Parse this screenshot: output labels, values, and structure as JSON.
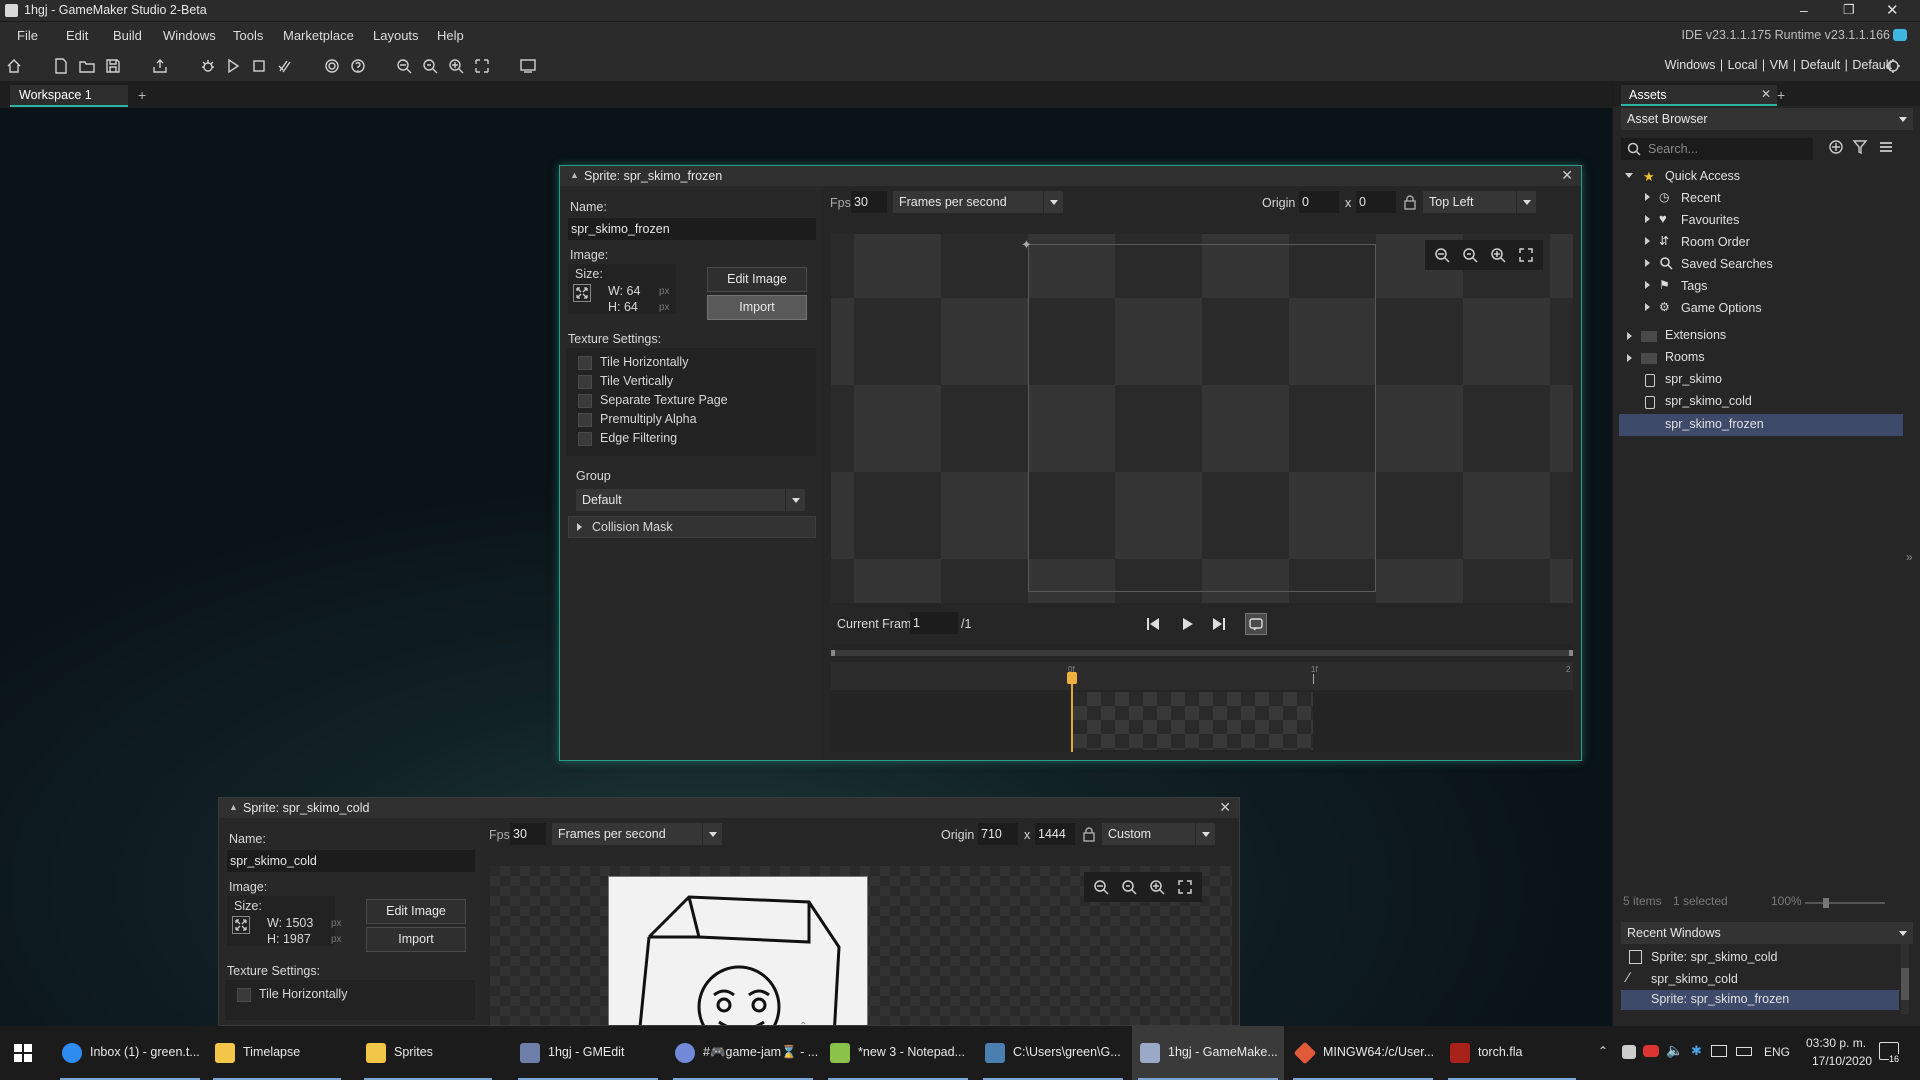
{
  "titlebar": {
    "title": "1hgj - GameMaker Studio 2-Beta"
  },
  "menu": [
    "File",
    "Edit",
    "Build",
    "Windows",
    "Tools",
    "Marketplace",
    "Layouts",
    "Help"
  ],
  "ide_version": "IDE v23.1.1.175  Runtime v23.1.1.166",
  "targets": "Windows  |  Local  |  VM  |  Default  |  Default",
  "workspace_tab": "Workspace 1",
  "add_tab": "+",
  "sprite_frozen": {
    "title": "Sprite: spr_skimo_frozen",
    "name_label": "Name:",
    "name": "spr_skimo_frozen",
    "image_label": "Image:",
    "size_label": "Size:",
    "w": "W: 64",
    "h": "H: 64",
    "px": "px",
    "edit_image": "Edit Image",
    "import": "Import",
    "texture_label": "Texture Settings:",
    "checkboxes": [
      "Tile Horizontally",
      "Tile Vertically",
      "Separate Texture Page",
      "Premultiply Alpha",
      "Edge Filtering"
    ],
    "group_label": "Group",
    "group": "Default",
    "collision": "Collision Mask",
    "fps_label": "Fps",
    "fps": "30",
    "fps_mode": "Frames per second",
    "origin_label": "Origin",
    "origin_x": "0",
    "x_sep": "x",
    "origin_y": "0",
    "origin_mode": "Top Left",
    "current_frame_label": "Current Frame:",
    "current_frame": "1",
    "frame_total": "/1",
    "frame_ticks": [
      "0f",
      "1f",
      "2"
    ]
  },
  "sprite_cold": {
    "title": "Sprite: spr_skimo_cold",
    "name_label": "Name:",
    "name": "spr_skimo_cold",
    "image_label": "Image:",
    "size_label": "Size:",
    "w": "W: 1503",
    "h": "H: 1987",
    "px": "px",
    "edit_image": "Edit Image",
    "import": "Import",
    "texture_label": "Texture Settings:",
    "checkbox": "Tile Horizontally",
    "fps_label": "Fps",
    "fps": "30",
    "fps_mode": "Frames per second",
    "origin_label": "Origin",
    "origin_x": "710",
    "x_sep": "x",
    "origin_y": "1444",
    "origin_mode": "Custom"
  },
  "assets": {
    "tab": "Assets",
    "tab_add": "+",
    "browser": "Asset Browser",
    "search_placeholder": "Search...",
    "quick_access": "Quick Access",
    "quick_items": [
      "Recent",
      "Favourites",
      "Room Order",
      "Saved Searches",
      "Tags",
      "Game Options"
    ],
    "folders": [
      "Extensions",
      "Rooms"
    ],
    "sprites": [
      "spr_skimo",
      "spr_skimo_cold",
      "spr_skimo_frozen"
    ],
    "status_items": "5 items",
    "status_selected": "1 selected",
    "zoom": "100%",
    "recent_title": "Recent Windows",
    "recent": [
      "Sprite: spr_skimo_cold",
      "spr_skimo_cold",
      "Sprite: spr_skimo_frozen"
    ]
  },
  "taskbar": {
    "tasks": [
      "Inbox (1) - green.t...",
      "Timelapse",
      "Sprites",
      "1hgj - GMEdit",
      "#🎮game-jam⌛ - ...",
      "*new 3 - Notepad...",
      "C:\\Users\\green\\G...",
      "1hgj - GameMake...",
      "MINGW64:/c/User...",
      "torch.fla"
    ],
    "lang": "ENG",
    "time": "03:30 p. m.",
    "date": "17/10/2020",
    "notif": "16"
  }
}
